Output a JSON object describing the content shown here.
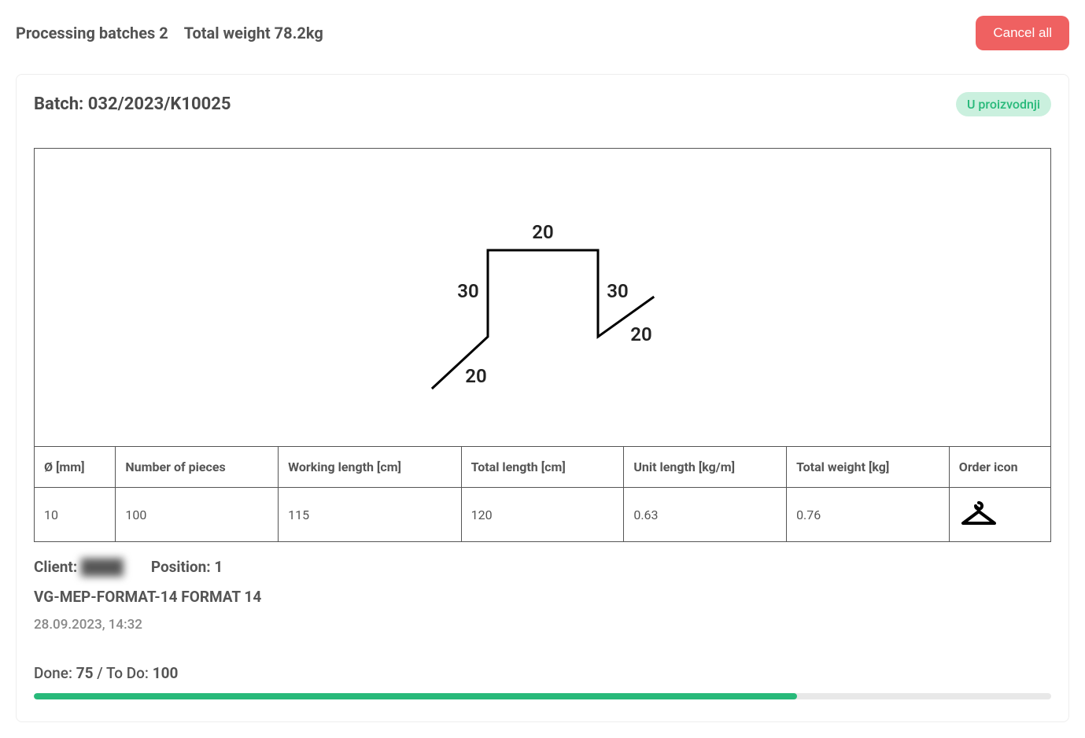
{
  "header": {
    "processing_label": "Processing batches",
    "processing_count": "2",
    "total_weight_label": "Total weight",
    "total_weight_value": "78.2kg",
    "cancel_all": "Cancel all"
  },
  "batch": {
    "title_prefix": "Batch:",
    "id": "032/2023/K10025",
    "status": "U proizvodnji"
  },
  "diagram": {
    "segments": [
      "20",
      "30",
      "20",
      "30",
      "20"
    ]
  },
  "table": {
    "headers": {
      "diameter": "Ø [mm]",
      "pieces": "Number of pieces",
      "working_length": "Working length [cm]",
      "total_length": "Total length [cm]",
      "unit_length": "Unit length [kg/m]",
      "total_weight": "Total weight [kg]",
      "order_icon": "Order icon"
    },
    "row": {
      "diameter": "10",
      "pieces": "100",
      "working_length": "115",
      "total_length": "120",
      "unit_length": "0.63",
      "total_weight": "0.76"
    }
  },
  "meta": {
    "client_label": "Client:",
    "client_value": "████",
    "position_label": "Position:",
    "position_value": "1",
    "format_line": "VG-MEP-FORMAT-14 FORMAT 14",
    "timestamp": "28.09.2023, 14:32"
  },
  "progress": {
    "done_label": "Done:",
    "done_value": "75",
    "sep": "/",
    "todo_label": "To Do:",
    "todo_value": "100",
    "percent": 75
  }
}
